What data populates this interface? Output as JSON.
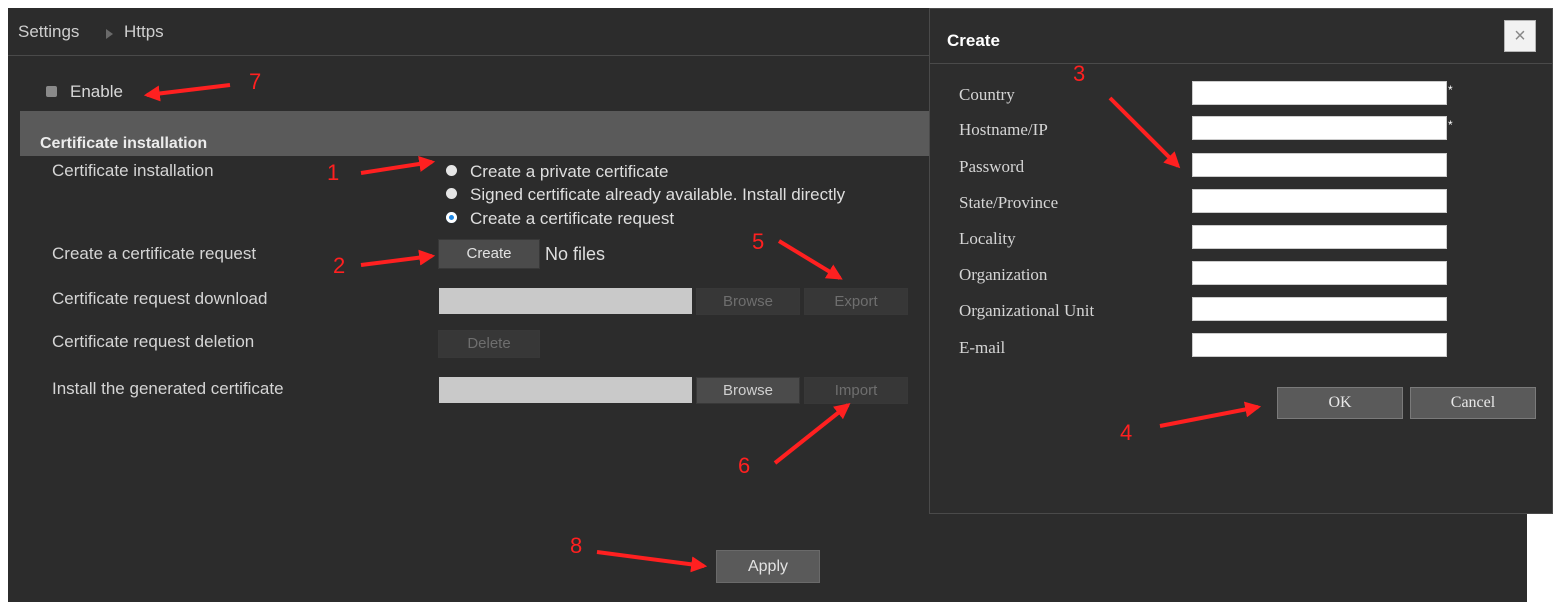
{
  "breadcrumb": {
    "settings": "Settings",
    "current": "Https"
  },
  "enable": {
    "label": "Enable",
    "checked": false
  },
  "section": {
    "title": "Certificate installation"
  },
  "rows": {
    "cert_install": "Certificate installation",
    "create_request": "Create a certificate request",
    "request_download": "Certificate request download",
    "request_deletion": "Certificate request deletion",
    "install_generated": "Install the generated certificate"
  },
  "radios": [
    {
      "label": "Create a private certificate",
      "selected": false
    },
    {
      "label": "Signed certificate already available. Install directly",
      "selected": false
    },
    {
      "label": "Create a certificate request",
      "selected": true
    }
  ],
  "buttons": {
    "create": "Create",
    "no_files": "No files",
    "browse": "Browse",
    "export": "Export",
    "delete": "Delete",
    "import": "Import",
    "apply": "Apply"
  },
  "dialog": {
    "title": "Create",
    "close": "×",
    "fields": [
      {
        "label": "Country",
        "required": true,
        "value": ""
      },
      {
        "label": "Hostname/IP",
        "required": true,
        "value": ""
      },
      {
        "label": "Password",
        "required": false,
        "value": ""
      },
      {
        "label": "State/Province",
        "required": false,
        "value": ""
      },
      {
        "label": "Locality",
        "required": false,
        "value": ""
      },
      {
        "label": "Organization",
        "required": false,
        "value": ""
      },
      {
        "label": "Organizational Unit",
        "required": false,
        "value": ""
      },
      {
        "label": "E-mail",
        "required": false,
        "value": ""
      }
    ],
    "required_mark": "*",
    "ok": "OK",
    "cancel": "Cancel"
  },
  "annotations": [
    "1",
    "2",
    "3",
    "4",
    "5",
    "6",
    "7",
    "8"
  ],
  "colors": {
    "annotation": "#ff2020",
    "selected_radio": "#1e88e5",
    "background": "#2c2c2c"
  }
}
